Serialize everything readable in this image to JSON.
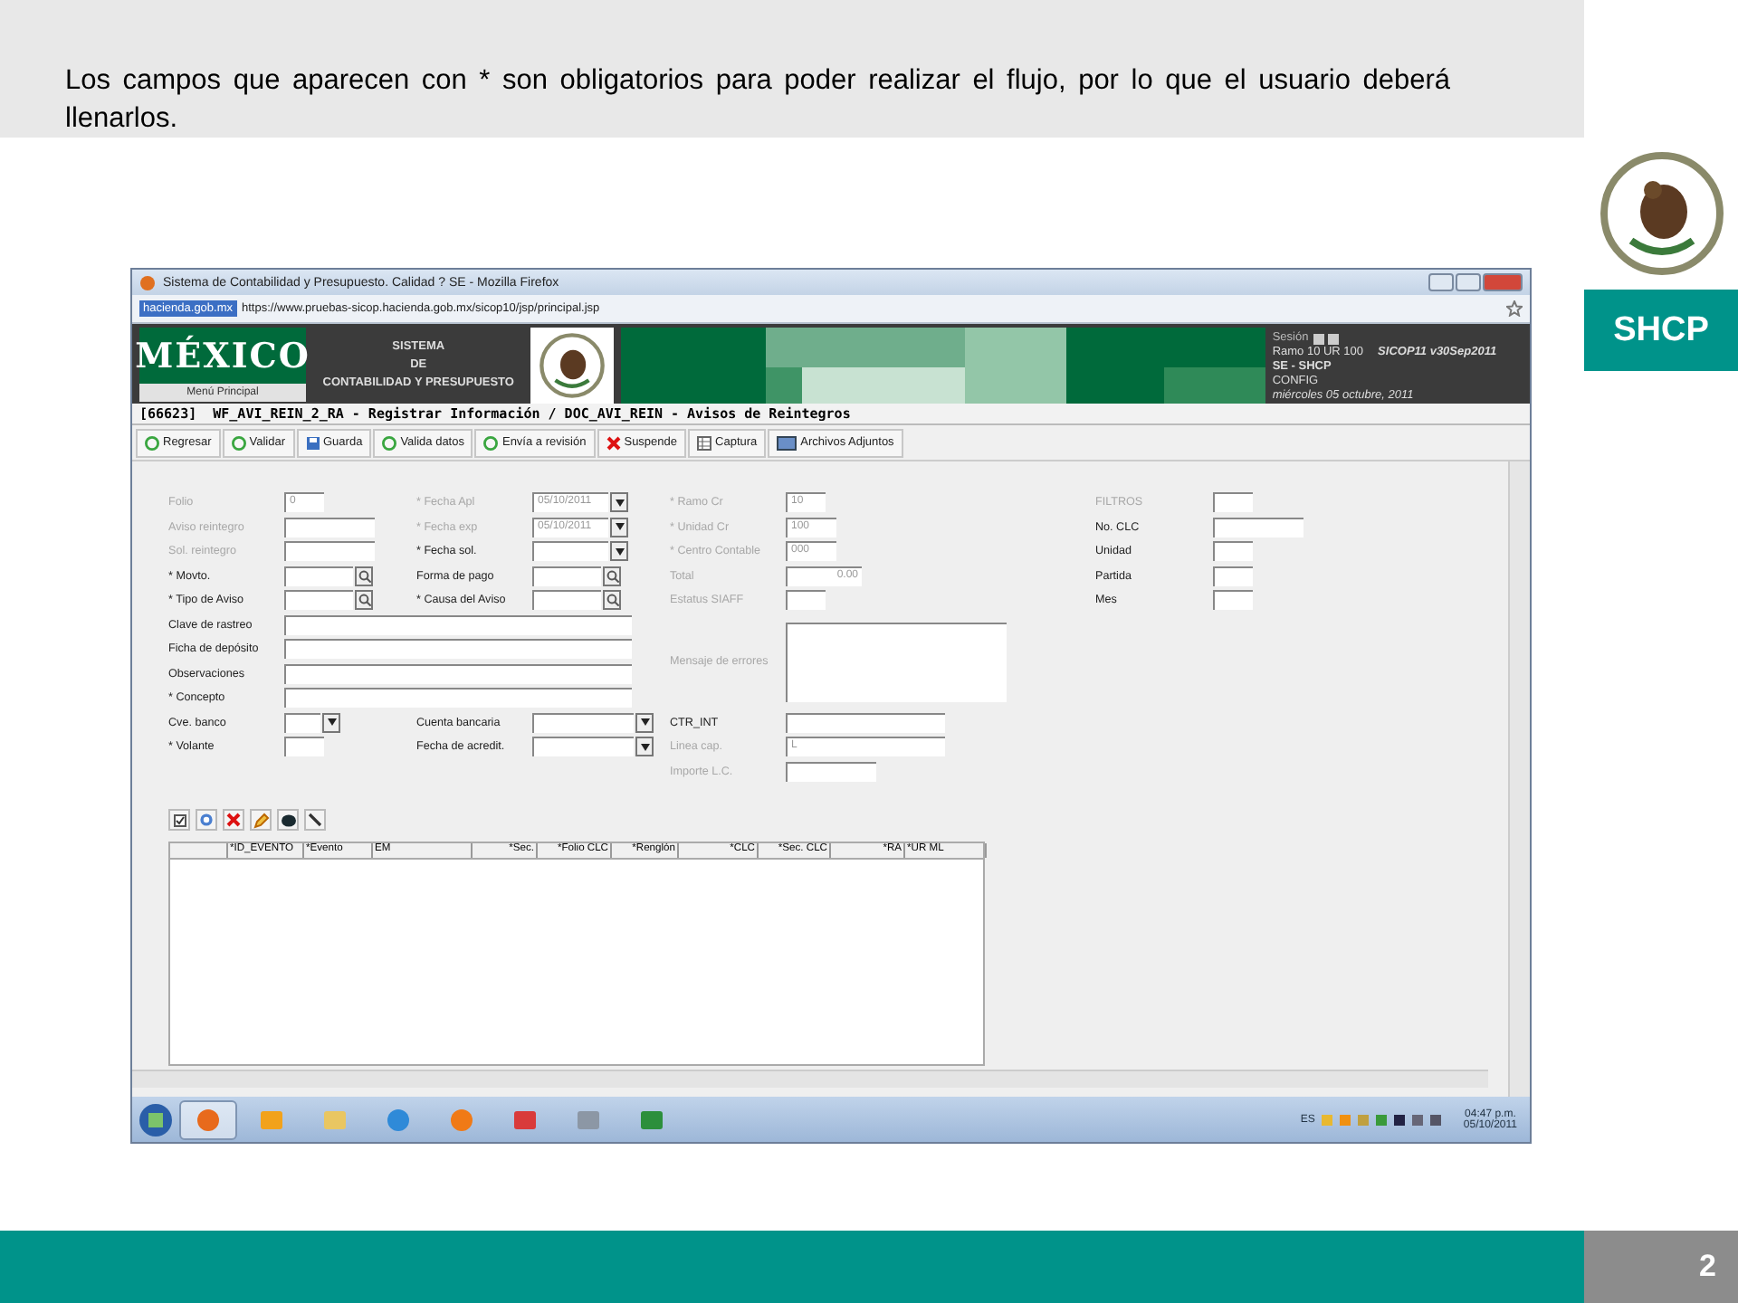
{
  "slide": {
    "note": "Los campos que aparecen con * son obligatorios para poder realizar el flujo, por lo que el usuario deberá llenarlos.",
    "logo": "SHCP",
    "page_number": "2"
  },
  "browser": {
    "title": "Sistema de Contabilidad y Presupuesto. Calidad ? SE - Mozilla Firefox",
    "site_badge": "hacienda.gob.mx",
    "url": "https://www.pruebas-sicop.hacienda.gob.mx/sicop10/jsp/principal.jsp"
  },
  "banner": {
    "brand": "MÉXICO",
    "menu": "Menú Principal",
    "system": [
      "SISTEMA",
      "DE",
      "CONTABILIDAD Y PRESUPUESTO"
    ],
    "session_label": "Sesión",
    "ramo": "Ramo 10 UR 100",
    "version": "SICOP11 v30Sep2011",
    "office": "SE - SHCP",
    "profile": "CONFIG",
    "date": "miércoles 05 octubre, 2011"
  },
  "header": "[66623]  WF_AVI_REIN_2_RA - Registrar Información / DOC_AVI_REIN - Avisos de Reintegros",
  "toolbar": [
    "Regresar",
    "Validar",
    "Guarda",
    "Valida datos",
    "Envía a revisión",
    "Suspende",
    "Captura",
    "Archivos Adjuntos"
  ],
  "form": {
    "rows": [
      {
        "left": {
          "label": "Folio",
          "kind": "tiny",
          "disabled": true,
          "value": "0"
        },
        "middle": {
          "label": "* Fecha Apl",
          "kind": "date",
          "disabled": true,
          "value": "05/10/2011"
        },
        "right": {
          "label": "* Ramo Cr",
          "kind": "tiny",
          "disabled": true,
          "value": "10"
        },
        "filter": {
          "label": "FILTROS",
          "kind": "tiny",
          "disabled": true
        }
      },
      {
        "left": {
          "label": "Aviso reintegro",
          "kind": "medium",
          "disabled": true
        },
        "middle": {
          "label": "* Fecha exp",
          "kind": "date",
          "disabled": true,
          "value": "05/10/2011"
        },
        "right": {
          "label": "* Unidad Cr",
          "kind": "small",
          "disabled": true,
          "value": "100"
        },
        "filter": {
          "label": "No. CLC",
          "kind": "medium",
          "disabled": false
        }
      },
      {
        "left": {
          "label": "Sol. reintegro",
          "kind": "medium",
          "disabled": true
        },
        "middle": {
          "label": "* Fecha sol.",
          "kind": "date",
          "disabled": false
        },
        "right": {
          "label": "* Centro Contable",
          "kind": "small",
          "disabled": true,
          "value": "000"
        },
        "filter": {
          "label": "Unidad",
          "kind": "tiny",
          "disabled": false
        }
      },
      {
        "left": {
          "label": "* Movto.",
          "kind": "lookup",
          "disabled": false
        },
        "middle": {
          "label": "Forma de pago",
          "kind": "lookup",
          "disabled": false
        },
        "right": {
          "label": "Total",
          "kind": "amount",
          "disabled": true,
          "value": "0.00"
        },
        "filter": {
          "label": "Partida",
          "kind": "tiny",
          "disabled": false
        }
      },
      {
        "left": {
          "label": "* Tipo de Aviso",
          "kind": "lookup",
          "disabled": false
        },
        "middle": {
          "label": "* Causa del Aviso",
          "kind": "lookup",
          "disabled": false
        },
        "right": {
          "label": "Estatus SIAFF",
          "kind": "tiny",
          "disabled": true
        },
        "filter": {
          "label": "Mes",
          "kind": "tiny",
          "disabled": false
        }
      },
      {
        "left": {
          "label": "Clave de rastreo",
          "kind": "wide",
          "disabled": false
        },
        "right": {
          "label": "Mensaje de errores",
          "kind": "area",
          "disabled": true
        }
      },
      {
        "left": {
          "label": "Ficha de depósito",
          "kind": "wide",
          "disabled": false
        }
      },
      {
        "left": {
          "label": "Observaciones",
          "kind": "wide",
          "disabled": false
        }
      },
      {
        "left": {
          "label": "* Concepto",
          "kind": "wide",
          "disabled": false
        }
      },
      {
        "left": {
          "label": "Cve. banco",
          "kind": "select",
          "disabled": false
        },
        "middle": {
          "label": "Cuenta bancaria",
          "kind": "select-long",
          "disabled": false
        },
        "right": {
          "label": "CTR_INT",
          "kind": "long",
          "disabled": false
        }
      },
      {
        "left": {
          "label": "* Volante",
          "kind": "tiny",
          "disabled": false
        },
        "middle": {
          "label": "Fecha de acredit.",
          "kind": "select-long",
          "disabled": false
        },
        "right": {
          "label": "Linea cap.",
          "kind": "long",
          "disabled": true,
          "value": "L"
        }
      },
      {
        "right": {
          "label": "Importe L.C.",
          "kind": "medium",
          "disabled": true
        }
      }
    ]
  },
  "table": {
    "columns": [
      "",
      "*ID_EVENTO",
      "*Evento",
      "EM",
      "*Sec.",
      "*Folio CLC",
      "*Renglón",
      "*CLC",
      "*Sec. CLC",
      "*RA",
      "*UR ML"
    ]
  },
  "taskbar": {
    "apps": [
      {
        "selected": true
      },
      {
        "selected": false
      },
      {
        "selected": false
      },
      {
        "selected": false
      },
      {
        "selected": false
      },
      {
        "selected": false
      },
      {
        "selected": false
      },
      {
        "selected": false
      }
    ],
    "language": "ES",
    "time": "04:47 p.m.",
    "date": "05/10/2011"
  }
}
